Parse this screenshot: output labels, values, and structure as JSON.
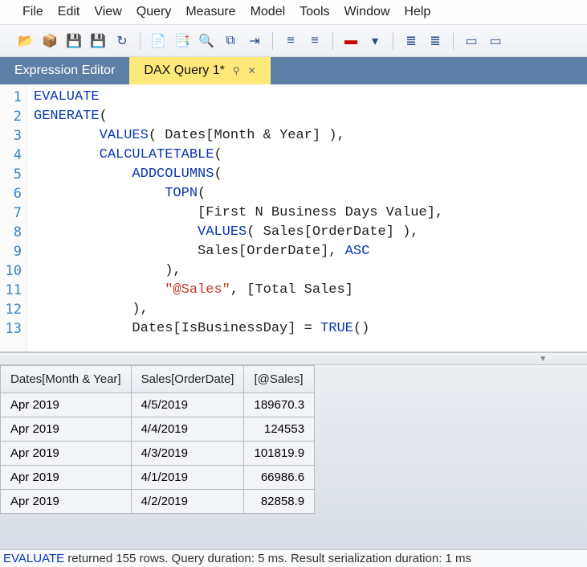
{
  "menubar": [
    "File",
    "Edit",
    "View",
    "Query",
    "Measure",
    "Model",
    "Tools",
    "Window",
    "Help"
  ],
  "tabs": {
    "expression_editor": "Expression Editor",
    "dax_query": "DAX Query 1*"
  },
  "gutter_lines": 13,
  "code_lines": [
    [
      [
        "kw",
        "EVALUATE"
      ]
    ],
    [
      [
        "kw",
        "GENERATE"
      ],
      [
        "par",
        "("
      ]
    ],
    [
      [
        "plain",
        "        "
      ],
      [
        "fn",
        "VALUES"
      ],
      [
        "par",
        "( "
      ],
      [
        "col",
        "Dates[Month & Year]"
      ],
      [
        "par",
        " ),"
      ]
    ],
    [
      [
        "plain",
        "        "
      ],
      [
        "fn",
        "CALCULATETABLE"
      ],
      [
        "par",
        "("
      ]
    ],
    [
      [
        "plain",
        "            "
      ],
      [
        "fn",
        "ADDCOLUMNS"
      ],
      [
        "par",
        "("
      ]
    ],
    [
      [
        "plain",
        "                "
      ],
      [
        "fn",
        "TOPN"
      ],
      [
        "par",
        "("
      ]
    ],
    [
      [
        "plain",
        "                    "
      ],
      [
        "col",
        "[First N Business Days Value]"
      ],
      [
        "par",
        ","
      ]
    ],
    [
      [
        "plain",
        "                    "
      ],
      [
        "fn",
        "VALUES"
      ],
      [
        "par",
        "( "
      ],
      [
        "col",
        "Sales[OrderDate]"
      ],
      [
        "par",
        " ),"
      ]
    ],
    [
      [
        "plain",
        "                    "
      ],
      [
        "col",
        "Sales[OrderDate]"
      ],
      [
        "par",
        ", "
      ],
      [
        "kw",
        "ASC"
      ]
    ],
    [
      [
        "plain",
        "                "
      ],
      [
        "par",
        "),"
      ]
    ],
    [
      [
        "plain",
        "                "
      ],
      [
        "str",
        "\"@Sales\""
      ],
      [
        "par",
        ", "
      ],
      [
        "col",
        "[Total Sales]"
      ]
    ],
    [
      [
        "plain",
        "            "
      ],
      [
        "par",
        "),"
      ]
    ],
    [
      [
        "plain",
        "            "
      ],
      [
        "col",
        "Dates[IsBusinessDay]"
      ],
      [
        "par",
        " = "
      ],
      [
        "fn",
        "TRUE"
      ],
      [
        "par",
        "()"
      ]
    ]
  ],
  "results": {
    "columns": [
      "Dates[Month & Year]",
      "Sales[OrderDate]",
      "[@Sales]"
    ],
    "rows": [
      [
        "Apr 2019",
        "4/5/2019",
        "189670.3"
      ],
      [
        "Apr 2019",
        "4/4/2019",
        "124553"
      ],
      [
        "Apr 2019",
        "4/3/2019",
        "101819.9"
      ],
      [
        "Apr 2019",
        "4/1/2019",
        "66986.6"
      ],
      [
        "Apr 2019",
        "4/2/2019",
        "82858.9"
      ]
    ]
  },
  "status": {
    "keyword": "EVALUATE",
    "rest": " returned 155 rows. Query duration: 5 ms. Result serialization duration: 1 ms"
  },
  "toolbar_icons": [
    "📂",
    "📦",
    "💾",
    "💾",
    "↻",
    "|",
    "📄",
    "📑",
    "🔍",
    "⧉",
    "⇥",
    "|",
    "≡",
    "≡",
    "|",
    "▬",
    "▾",
    "|",
    "≣",
    "≣",
    "|",
    "▭",
    "▭"
  ]
}
